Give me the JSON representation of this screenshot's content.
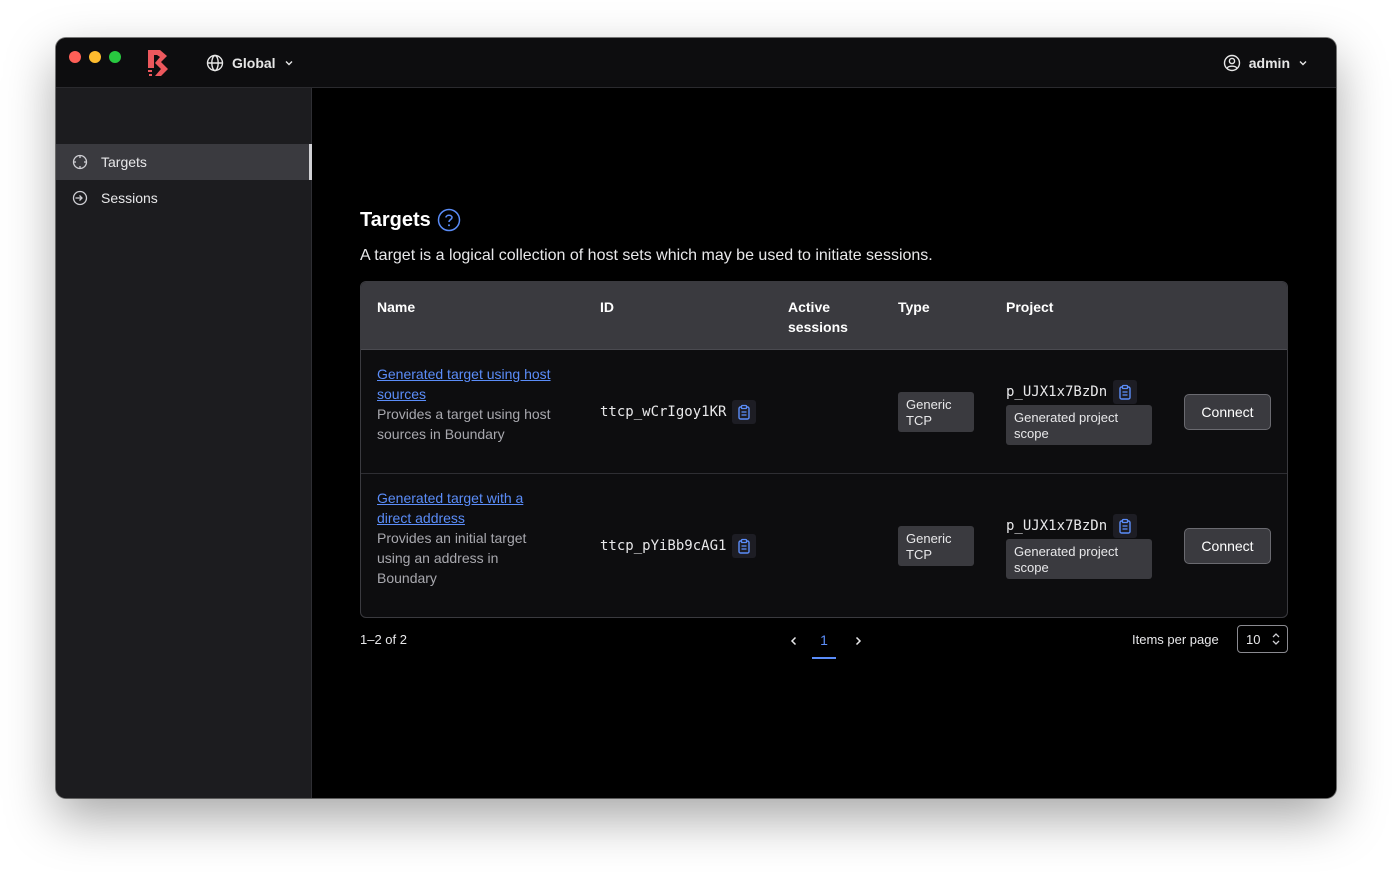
{
  "header": {
    "scope_label": "Global",
    "user_label": "admin"
  },
  "sidebar": {
    "items": [
      {
        "label": "Targets",
        "icon": "target-icon",
        "active": true
      },
      {
        "label": "Sessions",
        "icon": "sessions-icon",
        "active": false
      }
    ]
  },
  "main": {
    "title": "Targets",
    "description": "A target is a logical collection of host sets which may be used to initiate sessions."
  },
  "table": {
    "headers": {
      "name": "Name",
      "id": "ID",
      "active_line1": "Active",
      "active_line2": "sessions",
      "type": "Type",
      "project": "Project"
    },
    "rows": [
      {
        "name_line1": "Generated target using host",
        "name_line2": "sources",
        "desc_line1": "Provides a target using host",
        "desc_line2": "sources in Boundary",
        "desc_line3": "",
        "id": "ttcp_wCrIgoy1KR",
        "type_line1": "Generic",
        "type_line2": "TCP",
        "project_id": "p_UJX1x7BzDn",
        "project_line1": "Generated project",
        "project_line2": "scope",
        "action": "Connect"
      },
      {
        "name_line1": "Generated target with a",
        "name_line2": "direct address",
        "desc_line1": "Provides an initial target",
        "desc_line2": "using an address in",
        "desc_line3": "Boundary",
        "id": "ttcp_pYiBb9cAG1",
        "type_line1": "Generic",
        "type_line2": "TCP",
        "project_id": "p_UJX1x7BzDn",
        "project_line1": "Generated project",
        "project_line2": "scope",
        "action": "Connect"
      }
    ]
  },
  "pagination": {
    "range": "1–2 of 2",
    "current_page": "1",
    "items_per_page_label": "Items per page",
    "items_per_page": "10"
  },
  "colors": {
    "accent": "#5b8df9",
    "brand": "#ec585d",
    "sidebar_bg": "#1c1c1f",
    "header_bg": "#3a3a3f"
  }
}
